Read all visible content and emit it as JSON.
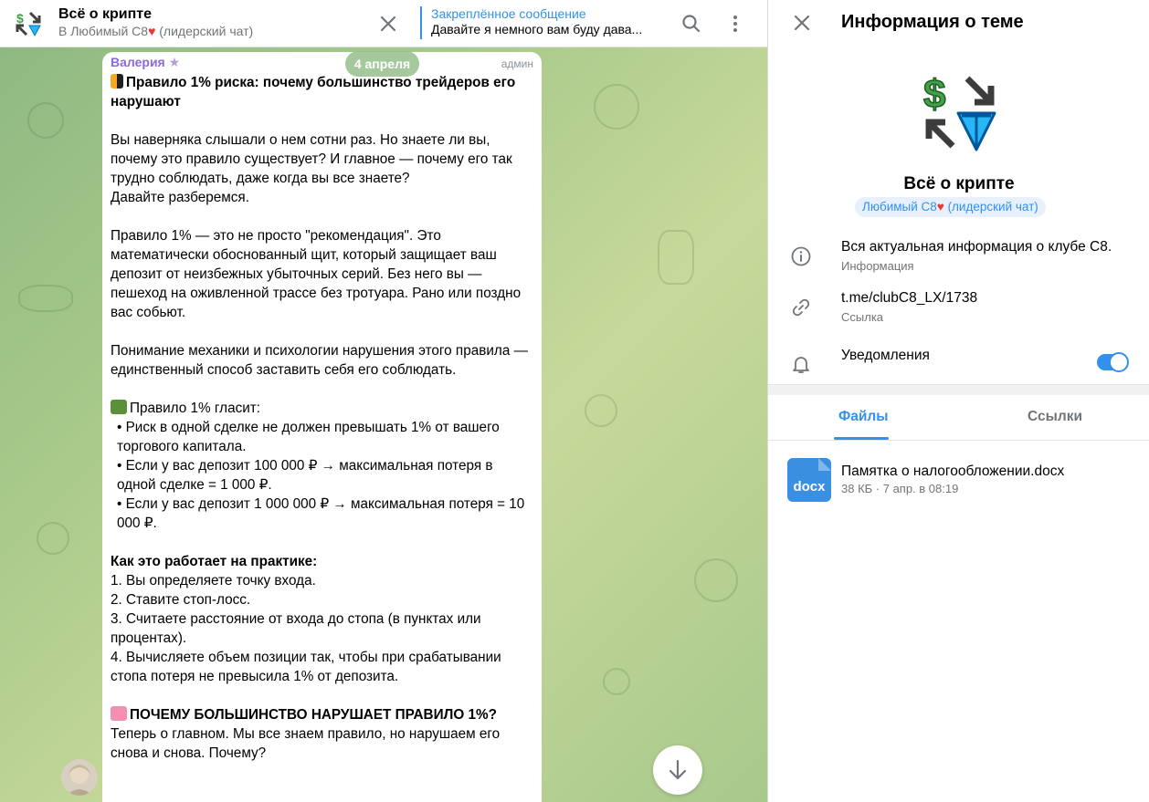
{
  "colors": {
    "accent": "#3390ec",
    "sender": "#8e6ad9",
    "heart": "#e53935"
  },
  "header": {
    "title": "Всё о крипте",
    "subtitle_prefix": "В Любимый C8",
    "subtitle_suffix": " (лидерский чат)",
    "pinned_label": "Закреплённое сообщение",
    "pinned_text": "Давайте я немного вам буду дава...",
    "icons": [
      "topic-icon",
      "close-icon",
      "search-icon",
      "more-vertical-icon"
    ]
  },
  "chat": {
    "date": "4 апреля",
    "message": {
      "sender": "Валерия",
      "role": "админ",
      "heading": "Правило 1% риска: почему большинство трейдеров его нарушают",
      "p1": [
        "Вы наверняка слышали о нем сотни раз. Но знаете ли вы, почему это правило существует? И главное — почему его так трудно соблюдать, даже когда вы все знаете?",
        "Давайте разберемся."
      ],
      "p2": "Правило 1% — это не просто \"рекомендация\". Это математически обоснованный щит, который защищает ваш депозит от неизбежных убыточных серий. Без него вы — пешеход на оживленной трассе без тротуара. Рано или поздно вас собьют.",
      "p3": "Понимание механики и психологии нарушения этого правила — единственный способ заставить себя его соблюдать.",
      "rule_title": "Правило 1% гласит:",
      "rule_items": [
        "• Риск в одной сделке не должен превышать 1% от вашего торгового капитала.",
        "• Если у вас депозит 100 000 ₽ → максимальная потеря в одной сделке = 1 000 ₽.",
        "• Если у вас депозит 1 000 000 ₽ → максимальная потеря = 10 000 ₽."
      ],
      "practice_title": "Как это работает на практике:",
      "practice_items": [
        "1. Вы определяете точку входа.",
        "2. Ставите стоп-лосс.",
        "3. Считаете расстояние от входа до стопа (в пунктах или процентах).",
        "4. Вычисляете объем позиции так, чтобы при срабатывании стопа потеря не превысила 1% от депозита."
      ],
      "why_title": "ПОЧЕМУ БОЛЬШИНСТВО НАРУШАЕТ ПРАВИЛО 1%?",
      "why_text": "Теперь о главном. Мы все знаем правило, но нарушаем его снова и снова. Почему?"
    }
  },
  "panel": {
    "title": "Информация о теме",
    "name": "Всё о крипте",
    "group_prefix": "Любимый C8",
    "group_suffix": " (лидерский чат)",
    "info_text": "Вся актуальная информация о клубе C8.",
    "info_label": "Информация",
    "link_text": "t.me/clubC8_LX/1738",
    "link_label": "Ссылка",
    "notifications_label": "Уведомления",
    "notifications_on": true,
    "tabs": [
      "Файлы",
      "Ссылки"
    ],
    "active_tab": "Файлы",
    "file": {
      "name": "Памятка о налогообложении.docx",
      "meta": "38 КБ · 7 апр. в 08:19",
      "ext": "docx"
    }
  }
}
